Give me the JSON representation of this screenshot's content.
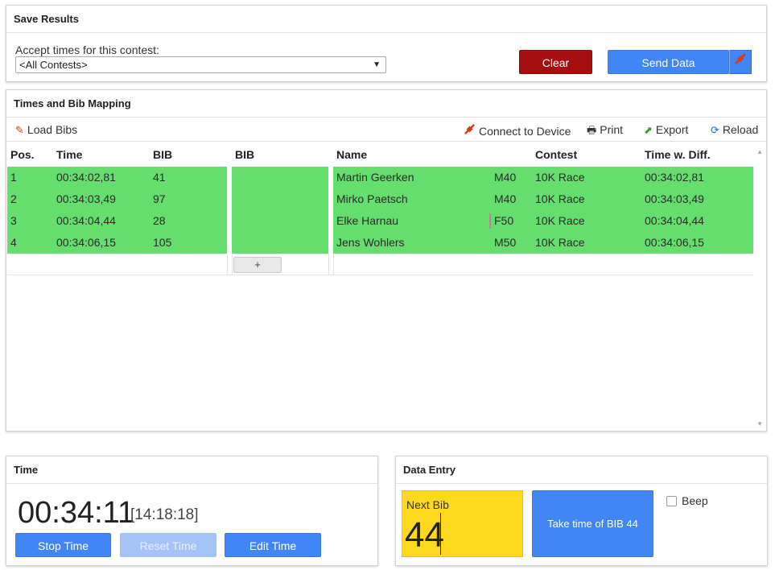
{
  "save_results": {
    "title": "Save Results",
    "accept_label": "Accept times for this contest:",
    "contest_select": "<All Contests>",
    "clear_label": "Clear",
    "send_label": "Send Data"
  },
  "times_panel": {
    "title": "Times and Bib Mapping",
    "toolbar": {
      "load_bibs": "Load Bibs",
      "connect": "Connect to Device",
      "print": "Print",
      "export": "Export",
      "reload": "Reload"
    },
    "headers": {
      "pos": "Pos.",
      "time": "Time",
      "bib": "BIB",
      "bib2": "BIB",
      "name": "Name",
      "contest": "Contest",
      "time_diff": "Time w. Diff."
    },
    "rows": [
      {
        "pos": "1",
        "time": "00:34:02,81",
        "bib": "41",
        "name": "Martin Geerken",
        "ag": "M40",
        "contest": "10K Race",
        "diff": "00:34:02,81"
      },
      {
        "pos": "2",
        "time": "00:34:03,49",
        "bib": "97",
        "name": "Mirko Paetsch",
        "ag": "M40",
        "contest": "10K Race",
        "diff": "00:34:03,49"
      },
      {
        "pos": "3",
        "time": "00:34:04,44",
        "bib": "28",
        "name": "Elke Harnau",
        "ag": "F50",
        "contest": "10K Race",
        "diff": "00:34:04,44"
      },
      {
        "pos": "4",
        "time": "00:34:06,15",
        "bib": "105",
        "name": "Jens Wohlers",
        "ag": "M50",
        "contest": "10K Race",
        "diff": "00:34:06,15"
      }
    ],
    "plus_label": "+"
  },
  "time_panel": {
    "title": "Time",
    "clock": "00:34:11",
    "clock_sub": "[14:18:18]",
    "stop_label": "Stop Time",
    "reset_label": "Reset Time",
    "edit_label": "Edit Time"
  },
  "data_entry": {
    "title": "Data Entry",
    "next_bib_label": "Next Bib",
    "next_bib_value": "44",
    "take_label": "Take time of BIB 44",
    "beep_label": "Beep"
  },
  "colors": {
    "row_green": "#66dd6f",
    "button_blue": "#4285f4",
    "button_red": "#a50e0e",
    "next_bib_yellow": "#fcd91f"
  }
}
